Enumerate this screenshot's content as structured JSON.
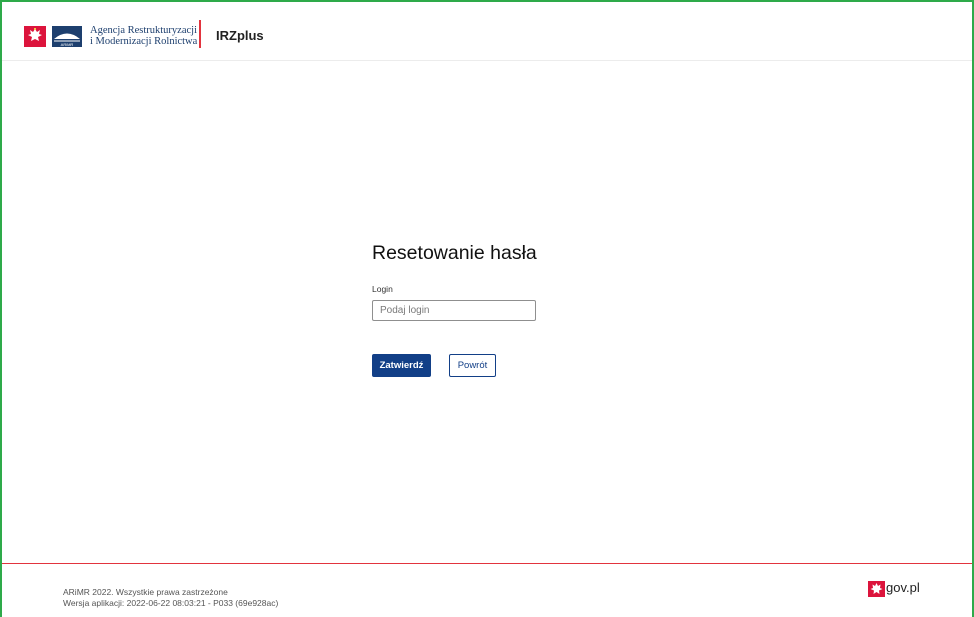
{
  "header": {
    "agency_line1": "Agencja Restrukturyzacji",
    "agency_line2": "i Modernizacji Rolnictwa",
    "arimr_logo_text": "ARiMR",
    "app_name": "IRZplus"
  },
  "form": {
    "title": "Resetowanie hasła",
    "login_label": "Login",
    "login_placeholder": "Podaj login",
    "login_value": "",
    "submit_label": "Zatwierdź",
    "back_label": "Powrót"
  },
  "footer": {
    "copyright": "ARiMR 2022. Wszystkie prawa zastrzeżone",
    "version": "Wersja aplikacji: 2022-06-22 08:03:21 - P033 (69e928ac)",
    "gov_label": "gov.pl"
  },
  "colors": {
    "frame": "#2eaa4a",
    "primary": "#123f87",
    "accent_red": "#e2343e"
  }
}
